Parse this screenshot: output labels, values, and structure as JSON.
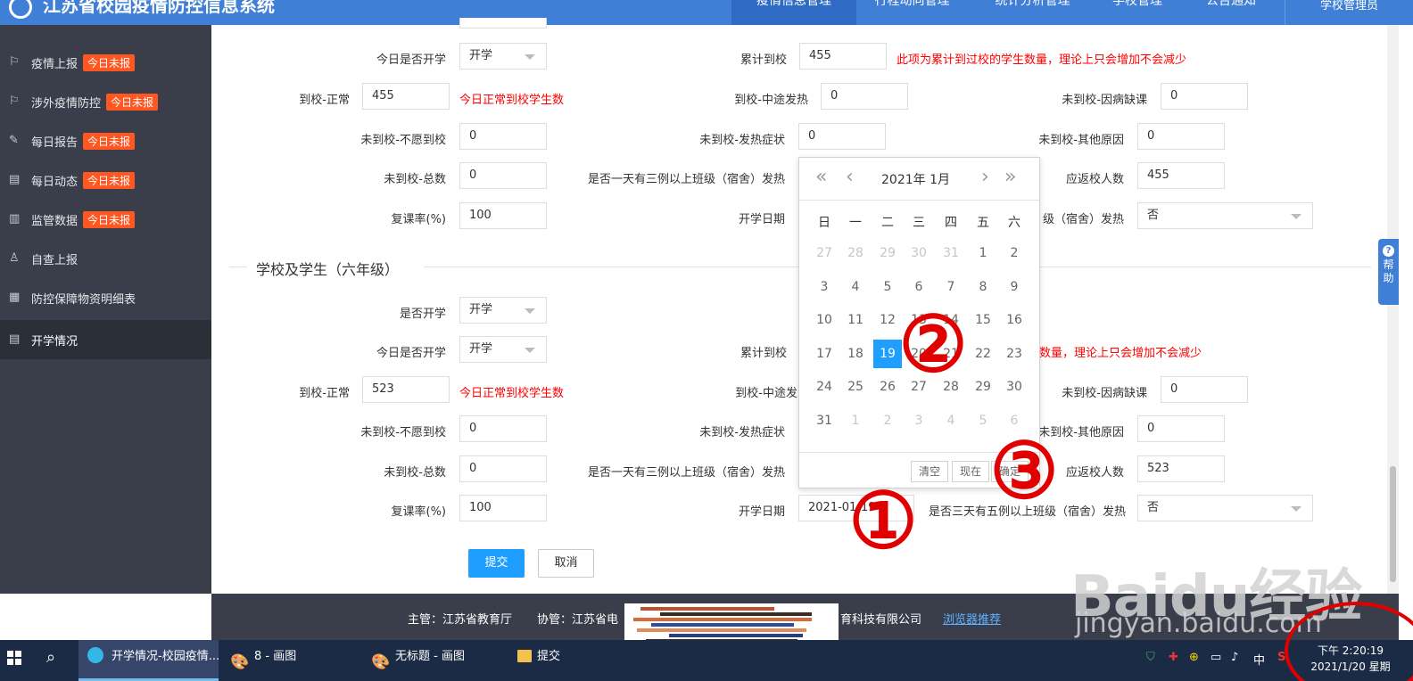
{
  "header": {
    "system_title": "江苏省校园疫情防控信息系统",
    "nav": [
      "疫情信息管理",
      "行程动向管理",
      "统计分析管理",
      "学校管理",
      "公告通知"
    ],
    "user": "学校管理员"
  },
  "sidebar": {
    "items": [
      {
        "label": "疫情上报",
        "badge": "今日未报"
      },
      {
        "label": "涉外疫情防控",
        "badge": "今日未报"
      },
      {
        "label": "每日报告",
        "badge": "今日未报"
      },
      {
        "label": "每日动态",
        "badge": "今日未报"
      },
      {
        "label": "监管数据",
        "badge": "今日未报"
      },
      {
        "label": "自查上报",
        "badge": ""
      },
      {
        "label": "防控保障物资明细表",
        "badge": ""
      },
      {
        "label": "开学情况",
        "badge": ""
      }
    ]
  },
  "form_top": {
    "today_open_label": "今日是否开学",
    "today_open_value": "开学",
    "cumulative_label": "累计到校",
    "cumulative_value": "455",
    "cumulative_note": "此项为累计到过校的学生数量，理论上只会增加不会减少",
    "normal_label": "到校-正常",
    "normal_value": "455",
    "normal_note": "今日正常到校学生数",
    "midfever_label": "到校-中途发热",
    "midfever_value": "0",
    "sick_label": "未到校-因病缺课",
    "sick_value": "0",
    "unwilling_label": "未到校-不愿到校",
    "unwilling_value": "0",
    "fever_label": "未到校-发热症状",
    "fever_value": "0",
    "other_label": "未到校-其他原因",
    "other_value": "0",
    "total_label": "未到校-总数",
    "total_value": "0",
    "class3_label": "是否一天有三例以上班级（宿舍）发热",
    "return_label": "应返校人数",
    "return_value": "455",
    "resume_label": "复课率(%)",
    "resume_value": "100",
    "start_label": "开学日期",
    "class5_partial": "级（宿舍）发热",
    "class5_value": "否"
  },
  "section_title": "学校及学生（六年级）",
  "form_bottom": {
    "open_label": "是否开学",
    "open_value": "开学",
    "today_open_label": "今日是否开学",
    "today_open_value": "开学",
    "cumulative_label": "累计到校",
    "cumulative_note_partial": "数量，理论上只会增加不会减少",
    "normal_label": "到校-正常",
    "normal_value": "523",
    "normal_note": "今日正常到校学生数",
    "midfever_partial": "到校-中途发",
    "sick_label": "未到校-因病缺课",
    "sick_value": "0",
    "unwilling_label": "未到校-不愿到校",
    "unwilling_value": "0",
    "fever_label": "未到校-发热症状",
    "other_partial": "未到校-其他原因",
    "other_value": "0",
    "total_label": "未到校-总数",
    "total_value": "0",
    "class3_label": "是否一天有三例以上班级（宿舍）发热",
    "return_label": "应返校人数",
    "return_value": "523",
    "resume_label": "复课率(%)",
    "resume_value": "100",
    "start_label": "开学日期",
    "start_value": "2021-01-19",
    "class5_label": "是否三天有五例以上班级（宿舍）发热",
    "class5_value": "否"
  },
  "buttons": {
    "submit": "提交",
    "cancel": "取消"
  },
  "help": {
    "label": "帮助",
    "icon": "?"
  },
  "datepicker": {
    "year_month": "2021年  1月",
    "weekdays": [
      "日",
      "一",
      "二",
      "三",
      "四",
      "五",
      "六"
    ],
    "weeks": [
      [
        "27",
        "28",
        "29",
        "30",
        "31",
        "1",
        "2"
      ],
      [
        "3",
        "4",
        "5",
        "6",
        "7",
        "8",
        "9"
      ],
      [
        "10",
        "11",
        "12",
        "13",
        "14",
        "15",
        "16"
      ],
      [
        "17",
        "18",
        "19",
        "20",
        "21",
        "22",
        "23"
      ],
      [
        "24",
        "25",
        "26",
        "27",
        "28",
        "29",
        "30"
      ],
      [
        "31",
        "1",
        "2",
        "3",
        "4",
        "5",
        "6"
      ]
    ],
    "selected": "19",
    "clear": "清空",
    "now": "现在",
    "confirm": "确定"
  },
  "footer": {
    "host_label": "主管：江苏省教育厅",
    "co_label": "协管：江苏省电",
    "co_tail": "育科技有限公司",
    "browser_link": "浏览器推荐"
  },
  "taskbar": {
    "items": [
      "开学情况-校园疫情...",
      "8 - 画图",
      "无标题 - 画图",
      "提交"
    ],
    "ime": "中",
    "time": "下午 2:20:19",
    "date": "2021/1/20 星期"
  },
  "annotations": {
    "one": "①",
    "two": "②",
    "three": "③"
  },
  "watermark": {
    "brand": "Baidu经验",
    "url": "jingyan.baidu.com"
  },
  "colors": {
    "topbar": "#3f7fd6",
    "sidebar": "#393e4a",
    "badge": "#ff5722",
    "primary": "#1e9fff",
    "annotation": "#e10000"
  }
}
